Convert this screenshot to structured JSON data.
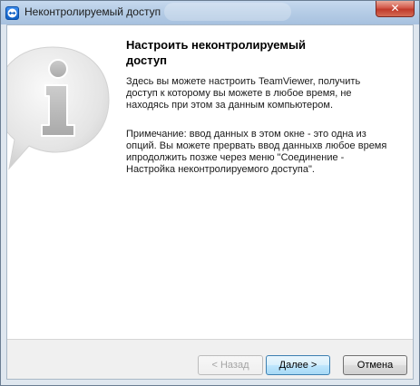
{
  "window": {
    "title": "Неконтролируемый доступ",
    "close_label": "✕",
    "app_icon": "teamviewer-icon"
  },
  "content": {
    "heading": "Настроить неконтролируемый доступ",
    "paragraph1": "Здесь вы можете настроить TeamViewer, получить доступ к которому вы можете в любое время, не находясь при этом за данным компьютером.",
    "paragraph2": "Примечание: ввод данных в этом окне  - это одна из опций. Вы можете прервать ввод данныхв любое время ипродолжить позже через меню \"Соединение - Настройка неконтролируемого доступа\".",
    "graphic_icon": "info-icon"
  },
  "buttons": {
    "back_label": "< Назад",
    "back_enabled": false,
    "next_label": "Далее >",
    "cancel_label": "Отмена"
  }
}
